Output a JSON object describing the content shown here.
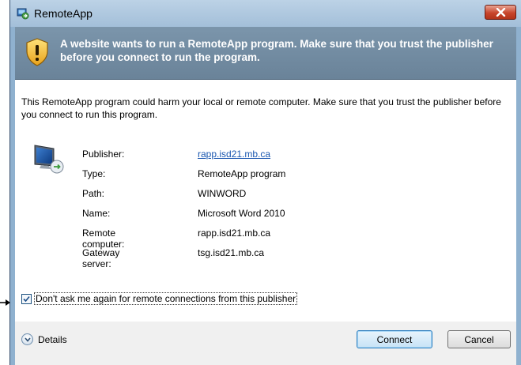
{
  "window": {
    "title": "RemoteApp",
    "close_icon": "close-icon"
  },
  "banner": {
    "icon": "shield-warning-icon",
    "text": "A website wants to run a RemoteApp program. Make sure that you trust the publisher before you connect to run the program."
  },
  "warning": {
    "text": "This RemoteApp program could harm your local or remote computer. Make sure that you trust the publisher before you connect to run this program."
  },
  "details": {
    "icon": "remote-computer-icon",
    "rows": [
      {
        "label": "Publisher:",
        "value": "rapp.isd21.mb.ca"
      },
      {
        "label": "Type:",
        "value": "RemoteApp program"
      },
      {
        "label": "Path:",
        "value": "WINWORD"
      },
      {
        "label": "Name:",
        "value": "Microsoft Word 2010"
      },
      {
        "label": "Remote computer:",
        "value": "rapp.isd21.mb.ca"
      },
      {
        "label": "Gateway server:",
        "value": "tsg.isd21.mb.ca"
      }
    ]
  },
  "checkbox": {
    "checked": true,
    "label": "Don't ask me again for remote connections from this publisher"
  },
  "footer": {
    "details_label": "Details",
    "connect_label": "Connect",
    "cancel_label": "Cancel"
  },
  "colors": {
    "banner": "#6a8399",
    "link": "#1a57b0",
    "close": "#c8452c"
  }
}
